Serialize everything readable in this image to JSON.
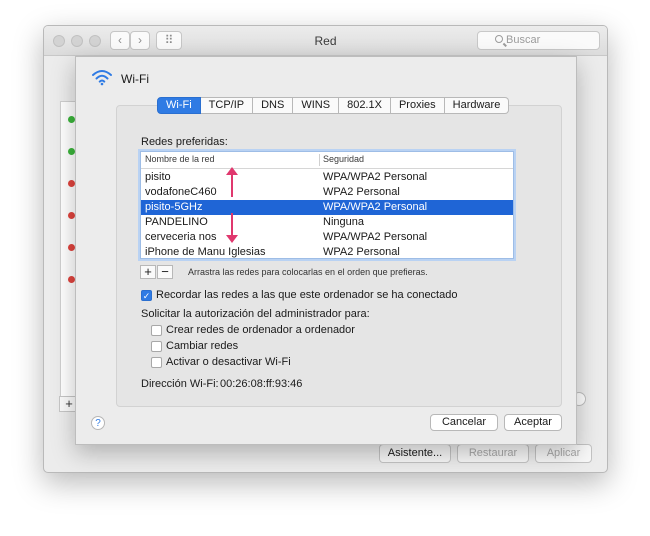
{
  "window": {
    "title": "Red",
    "search_placeholder": "Buscar"
  },
  "toolbar": {
    "back": "‹",
    "forward": "›",
    "grid": "⠿"
  },
  "sheet": {
    "title": "Wi-Fi",
    "tabs": [
      {
        "label": "Wi-Fi",
        "active": true
      },
      {
        "label": "TCP/IP",
        "active": false
      },
      {
        "label": "DNS",
        "active": false
      },
      {
        "label": "WINS",
        "active": false
      },
      {
        "label": "802.1X",
        "active": false
      },
      {
        "label": "Proxies",
        "active": false
      },
      {
        "label": "Hardware",
        "active": false
      }
    ],
    "preferred_label": "Redes preferidas:",
    "table": {
      "headers": [
        "Nombre de la red",
        "Seguridad"
      ],
      "rows": [
        {
          "name": "pisito",
          "security": "WPA/WPA2 Personal",
          "selected": false
        },
        {
          "name": "vodafoneC460",
          "security": "WPA2 Personal",
          "selected": false
        },
        {
          "name": "pisito-5GHz",
          "security": "WPA/WPA2 Personal",
          "selected": true
        },
        {
          "name": "PANDELINO",
          "security": "Ninguna",
          "selected": false
        },
        {
          "name": "cerveceria nos",
          "security": "WPA/WPA2 Personal",
          "selected": false
        },
        {
          "name": "iPhone de Manu Iglesias",
          "security": "WPA2 Personal",
          "selected": false
        }
      ]
    },
    "add_label": "+",
    "remove_label": "−",
    "drag_hint": "Arrastra las redes para colocarlas en el orden que prefieras.",
    "remember": {
      "label": "Recordar las redes a las que este ordenador se ha conectado",
      "checked": true
    },
    "admin_label": "Solicitar la autorización del administrador para:",
    "admin_options": [
      {
        "label": "Crear redes de ordenador a ordenador",
        "checked": false
      },
      {
        "label": "Cambiar redes",
        "checked": false
      },
      {
        "label": "Activar o desactivar Wi-Fi",
        "checked": false
      }
    ],
    "mac_label": "Dirección Wi-Fi:",
    "mac_value": "00:26:08:ff:93:46",
    "help": "?",
    "cancel": "Cancelar",
    "accept": "Aceptar"
  },
  "footer": {
    "assistant": "Asistente...",
    "restore": "Restaurar",
    "apply": "Aplicar"
  },
  "status_dots": [
    "#3bb53b",
    "#3bb53b",
    "#e0443e",
    "#e0443e",
    "#e0443e",
    "#e0443e",
    "#e0443e"
  ],
  "colors": {
    "accent": "#2f7be4",
    "selection": "#1f65d6",
    "arrow": "#e0386e"
  }
}
